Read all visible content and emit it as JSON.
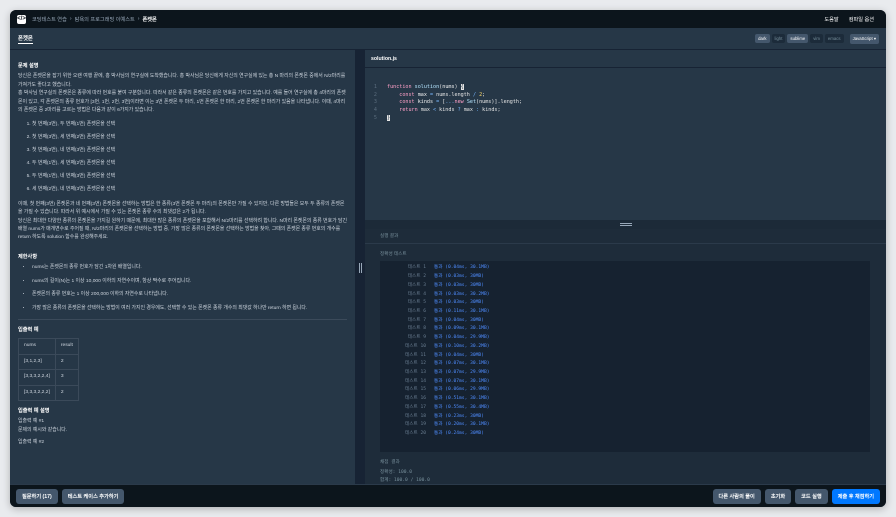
{
  "topbar": {
    "breadcrumbs": [
      "코딩테스트 연습",
      "탐욕의 프로그래밍 이예스트",
      "폰켓몬"
    ],
    "right_links": [
      "도움말",
      "컴파일 옵션"
    ]
  },
  "titlebar": {
    "title": "폰켓몬",
    "themes": [
      "dark",
      "light",
      "sublime",
      "vim",
      "emacs"
    ],
    "language": "JavaScript ▾"
  },
  "problem": {
    "heading": "문제 설명",
    "paragraphs": [
      "당신은 폰켓몬을 잡기 위한 오랜 여행 끝에, 홍 박사님의 연구실에 도착했습니다. 홍 박사님은 당신에게 자신의 연구실에 있는 총 N 마리의 폰켓몬 중에서 N/2마리를 가져가도 좋다고 했습니다.",
      "홍 박사님 연구실의 폰켓몬은 종류에 따라 번호를 붙여 구분합니다. 따라서 같은 종류의 폰켓몬은 같은 번호를 가지고 있습니다. 예를 들어 연구실에 총 4마리의 폰켓몬이 있고, 각 폰켓몬의 종류 번호가 [3번, 1번, 2번, 3번]이라면 이는 3번 폰켓몬 두 마리, 1번 폰켓몬 한 마리, 2번 폰켓몬 한 마리가 있음을 나타냅니다. 이때, 4마리의 폰켓몬 중 2마리를 고르는 방법은 다음과 같이 6가지가 있습니다."
    ],
    "choices": [
      "첫 번째(3번), 두 번째(1번) 폰켓몬을 선택",
      "첫 번째(3번), 세 번째(2번) 폰켓몬을 선택",
      "첫 번째(3번), 네 번째(3번) 폰켓몬을 선택",
      "두 번째(1번), 세 번째(2번) 폰켓몬을 선택",
      "두 번째(1번), 네 번째(3번) 폰켓몬을 선택",
      "세 번째(2번), 네 번째(3번) 폰켓몬을 선택"
    ],
    "after": [
      "이때, 첫 번째(3번) 폰켓몬과 네 번째(3번) 폰켓몬을 선택하는 방법은 한 종류(3번 폰켓몬 두 마리)의 폰켓몬만 가질 수 있지만, 다른 방법들은 모두 두 종류의 폰켓몬을 가질 수 있습니다. 따라서 위 예시에서 가질 수 있는 폰켓몬 종류 수의 최댓값은 2가 됩니다.",
      "당신은 최대한 다양한 종류의 폰켓몬을 가지길 원하기 때문에, 최대한 많은 종류의 폰켓몬을 포함해서 N/2마리를 선택하려 합니다. N마리 폰켓몬의 종류 번호가 담긴 배열 nums가 매개변수로 주어질 때, N/2마리의 폰켓몬을 선택하는 방법 중, 가장 많은 종류의 폰켓몬을 선택하는 방법을 찾아, 그때의 폰켓몬 종류 번호의 개수를 return 하도록 solution 함수를 완성해주세요."
    ],
    "constraints_heading": "제한사항",
    "constraints": [
      "nums는 폰켓몬의 종류 번호가 담긴 1차원 배열입니다.",
      "nums의 길이(N)는 1 이상 10,000 이하의 자연수이며, 항상 짝수로 주어집니다.",
      "폰켓몬의 종류 번호는 1 이상 200,000 이하의 자연수로 나타냅니다.",
      "가장 많은 종류의 폰켓몬을 선택하는 방법이 여러 가지인 경우에도, 선택할 수 있는 폰켓몬 종류 개수의 최댓값 하나만 return 하면 됩니다."
    ],
    "io_heading": "입출력 예",
    "io_columns": [
      "nums",
      "result"
    ],
    "io_rows": [
      [
        "[3,1,2,3]",
        "2"
      ],
      [
        "[3,3,3,2,2,4]",
        "3"
      ],
      [
        "[3,3,3,2,2,2]",
        "2"
      ]
    ],
    "io_desc_heading": "입출력 예 설명",
    "io_ex1": "입출력 예 #1",
    "io_ex1_text": "문제의 예시와 같습니다.",
    "io_ex2": "입출력 예 #2"
  },
  "editor": {
    "filename": "solution.js",
    "line_numbers": [
      "1",
      "2",
      "3",
      "4",
      "5"
    ]
  },
  "output": {
    "header": "실행 결과",
    "run_label": "정확성  테스트",
    "tests": [
      {
        "name": "테스트 1",
        "result": "통과 (0.04ms, 30.1MB)"
      },
      {
        "name": "테스트 2",
        "result": "통과 (0.03ms, 30MB)"
      },
      {
        "name": "테스트 3",
        "result": "통과 (0.03ms, 30MB)"
      },
      {
        "name": "테스트 4",
        "result": "통과 (0.03ms, 30.2MB)"
      },
      {
        "name": "테스트 5",
        "result": "통과 (0.03ms, 30MB)"
      },
      {
        "name": "테스트 6",
        "result": "통과 (0.11ms, 30.1MB)"
      },
      {
        "name": "테스트 7",
        "result": "통과 (0.04ms, 30MB)"
      },
      {
        "name": "테스트 8",
        "result": "통과 (0.09ms, 30.1MB)"
      },
      {
        "name": "테스트 9",
        "result": "통과 (0.04ms, 29.9MB)"
      },
      {
        "name": "테스트 10",
        "result": "통과 (0.10ms, 30.2MB)"
      },
      {
        "name": "테스트 11",
        "result": "통과 (0.04ms, 30MB)"
      },
      {
        "name": "테스트 12",
        "result": "통과 (0.07ms, 30.1MB)"
      },
      {
        "name": "테스트 13",
        "result": "통과 (0.07ms, 29.9MB)"
      },
      {
        "name": "테스트 14",
        "result": "통과 (0.07ms, 30.1MB)"
      },
      {
        "name": "테스트 15",
        "result": "통과 (0.06ms, 29.9MB)"
      },
      {
        "name": "테스트 16",
        "result": "통과 (0.51ms, 30.1MB)"
      },
      {
        "name": "테스트 17",
        "result": "통과 (0.55ms, 30.4MB)"
      },
      {
        "name": "테스트 18",
        "result": "통과 (0.23ms, 30MB)"
      },
      {
        "name": "테스트 19",
        "result": "통과 (0.20ms, 30.1MB)"
      },
      {
        "name": "테스트 20",
        "result": "통과 (0.24ms, 30MB)"
      }
    ],
    "score_heading": "채점 결과",
    "accuracy": "정확성: 100.0",
    "total": "합계: 100.0 / 100.0"
  },
  "bottom": {
    "ask": "질문하기 (17)",
    "add_testcase": "테스트 케이스 추가하기",
    "others": "다른 사람의 풀이",
    "reset": "초기화",
    "run": "코드 실행",
    "submit": "제출 후 채점하기"
  }
}
